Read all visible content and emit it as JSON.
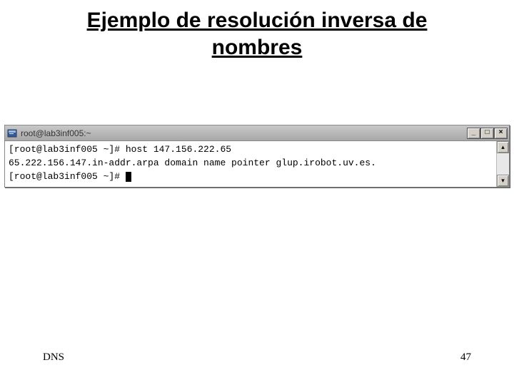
{
  "slide": {
    "title": "Ejemplo de resolución inversa de nombres"
  },
  "window": {
    "title": "root@lab3inf005:~"
  },
  "terminal": {
    "lines": [
      "[root@lab3inf005 ~]# host 147.156.222.65",
      "65.222.156.147.in-addr.arpa domain name pointer glup.irobot.uv.es.",
      "[root@lab3inf005 ~]# "
    ]
  },
  "footer": {
    "left": "DNS",
    "right": "47"
  }
}
